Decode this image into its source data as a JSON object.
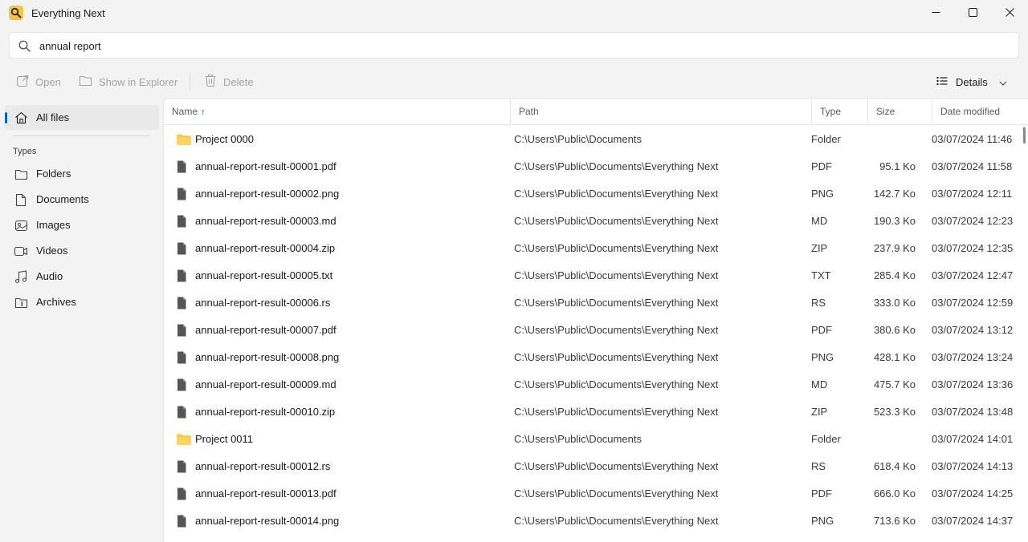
{
  "window": {
    "title": "Everything Next",
    "minimize_icon": "minimize-icon",
    "maximize_icon": "maximize-icon",
    "close_icon": "close-icon"
  },
  "search": {
    "value": "annual report",
    "icon": "search-icon"
  },
  "toolbar": {
    "open_label": "Open",
    "show_in_explorer_label": "Show in Explorer",
    "delete_label": "Delete",
    "view_label": "Details"
  },
  "sidebar": {
    "all_files_label": "All files",
    "types_heading": "Types",
    "items": [
      {
        "label": "Folders",
        "icon": "folder-icon"
      },
      {
        "label": "Documents",
        "icon": "document-icon"
      },
      {
        "label": "Images",
        "icon": "image-icon"
      },
      {
        "label": "Videos",
        "icon": "video-icon"
      },
      {
        "label": "Audio",
        "icon": "audio-icon"
      },
      {
        "label": "Archives",
        "icon": "archive-icon"
      }
    ]
  },
  "table": {
    "columns": {
      "name": "Name",
      "path": "Path",
      "type": "Type",
      "size": "Size",
      "date": "Date modified"
    },
    "sort_indicator": "↑",
    "rows": [
      {
        "name": "Project 0000",
        "path": "C:\\Users\\Public\\Documents",
        "type": "Folder",
        "size": "",
        "date": "03/07/2024 11:46",
        "kind": "folder"
      },
      {
        "name": "annual-report-result-00001.pdf",
        "path": "C:\\Users\\Public\\Documents\\Everything Next",
        "type": "PDF",
        "size": "95.1 Ko",
        "date": "03/07/2024 11:58",
        "kind": "file"
      },
      {
        "name": "annual-report-result-00002.png",
        "path": "C:\\Users\\Public\\Documents\\Everything Next",
        "type": "PNG",
        "size": "142.7 Ko",
        "date": "03/07/2024 12:11",
        "kind": "file"
      },
      {
        "name": "annual-report-result-00003.md",
        "path": "C:\\Users\\Public\\Documents\\Everything Next",
        "type": "MD",
        "size": "190.3 Ko",
        "date": "03/07/2024 12:23",
        "kind": "file"
      },
      {
        "name": "annual-report-result-00004.zip",
        "path": "C:\\Users\\Public\\Documents\\Everything Next",
        "type": "ZIP",
        "size": "237.9 Ko",
        "date": "03/07/2024 12:35",
        "kind": "file"
      },
      {
        "name": "annual-report-result-00005.txt",
        "path": "C:\\Users\\Public\\Documents\\Everything Next",
        "type": "TXT",
        "size": "285.4 Ko",
        "date": "03/07/2024 12:47",
        "kind": "file"
      },
      {
        "name": "annual-report-result-00006.rs",
        "path": "C:\\Users\\Public\\Documents\\Everything Next",
        "type": "RS",
        "size": "333.0 Ko",
        "date": "03/07/2024 12:59",
        "kind": "file"
      },
      {
        "name": "annual-report-result-00007.pdf",
        "path": "C:\\Users\\Public\\Documents\\Everything Next",
        "type": "PDF",
        "size": "380.6 Ko",
        "date": "03/07/2024 13:12",
        "kind": "file"
      },
      {
        "name": "annual-report-result-00008.png",
        "path": "C:\\Users\\Public\\Documents\\Everything Next",
        "type": "PNG",
        "size": "428.1 Ko",
        "date": "03/07/2024 13:24",
        "kind": "file"
      },
      {
        "name": "annual-report-result-00009.md",
        "path": "C:\\Users\\Public\\Documents\\Everything Next",
        "type": "MD",
        "size": "475.7 Ko",
        "date": "03/07/2024 13:36",
        "kind": "file"
      },
      {
        "name": "annual-report-result-00010.zip",
        "path": "C:\\Users\\Public\\Documents\\Everything Next",
        "type": "ZIP",
        "size": "523.3 Ko",
        "date": "03/07/2024 13:48",
        "kind": "file"
      },
      {
        "name": "Project 0011",
        "path": "C:\\Users\\Public\\Documents",
        "type": "Folder",
        "size": "",
        "date": "03/07/2024 14:01",
        "kind": "folder"
      },
      {
        "name": "annual-report-result-00012.rs",
        "path": "C:\\Users\\Public\\Documents\\Everything Next",
        "type": "RS",
        "size": "618.4 Ko",
        "date": "03/07/2024 14:13",
        "kind": "file"
      },
      {
        "name": "annual-report-result-00013.pdf",
        "path": "C:\\Users\\Public\\Documents\\Everything Next",
        "type": "PDF",
        "size": "666.0 Ko",
        "date": "03/07/2024 14:25",
        "kind": "file"
      },
      {
        "name": "annual-report-result-00014.png",
        "path": "C:\\Users\\Public\\Documents\\Everything Next",
        "type": "PNG",
        "size": "713.6 Ko",
        "date": "03/07/2024 14:37",
        "kind": "file"
      }
    ]
  },
  "colors": {
    "accent": "#0067c0",
    "folder": "#f7c948",
    "file_icon": "#555555",
    "sidebar_bg": "#f3f3f3",
    "content_bg": "#ffffff"
  }
}
